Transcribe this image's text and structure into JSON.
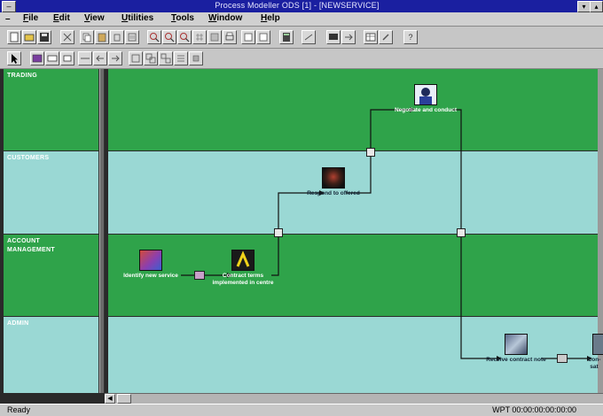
{
  "window": {
    "title": "Process Modeller ODS [1] - [NEWSERVICE]",
    "system_menu_glyph": "–",
    "minimize_glyph": "▾",
    "maximize_glyph": "▴"
  },
  "menu": {
    "system_glyph": "–",
    "items": [
      {
        "underline": "F",
        "rest": "ile"
      },
      {
        "underline": "E",
        "rest": "dit"
      },
      {
        "underline": "V",
        "rest": "iew"
      },
      {
        "underline": "U",
        "rest": "tilities"
      },
      {
        "underline": "T",
        "rest": "ools"
      },
      {
        "underline": "W",
        "rest": "indow"
      },
      {
        "underline": "H",
        "rest": "elp"
      }
    ]
  },
  "toolbar": {
    "help_glyph": "?"
  },
  "lanes": [
    {
      "label": "TRADING",
      "color": "#2fa34a"
    },
    {
      "label": "CUSTOMERS",
      "color": "#9ad8d4"
    },
    {
      "label": "ACCOUNT MANAGEMENT",
      "color": "#2fa34a"
    },
    {
      "label": "ADMIN",
      "color": "#9ad8d4"
    }
  ],
  "nodes": {
    "identify": "Identify new service",
    "contract_terms": "Contract terms implemented in centre",
    "respond": "Respond to offered",
    "negotiate": "Negotiate and conduct",
    "receive": "Receive contract note",
    "partial": "Con- sat"
  },
  "status": {
    "left": "Ready",
    "right": "WPT 00:00:00:00:00:00"
  },
  "colors": {
    "lane_dark": "#2fa34a",
    "lane_light": "#9ad8d4",
    "title_bar": "#1a1fa0"
  }
}
